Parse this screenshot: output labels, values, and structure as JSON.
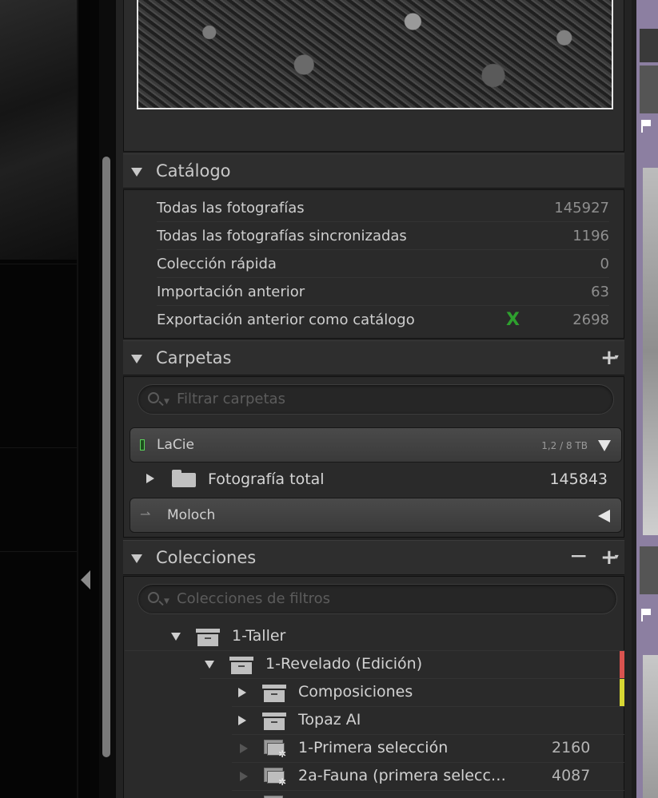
{
  "catalog": {
    "title": "Catálogo",
    "rows": [
      {
        "label": "Todas las fotografías",
        "count": "145927"
      },
      {
        "label": "Todas las fotografías sincronizadas",
        "count": "1196"
      },
      {
        "label": "Colección rápida",
        "count": "0"
      },
      {
        "label": "Importación anterior",
        "count": "63"
      },
      {
        "label": "Exportación anterior como catálogo",
        "count": "2698",
        "mark": "X"
      }
    ]
  },
  "folders": {
    "title": "Carpetas",
    "filter_placeholder": "Filtrar carpetas",
    "volume1": {
      "name": "LaCie",
      "size": "1,2 / 8 TB"
    },
    "folder": {
      "label": "Fotografía total",
      "count": "145843"
    },
    "volume2": {
      "name": "Moloch"
    }
  },
  "collections": {
    "title": "Colecciones",
    "filter_placeholder": "Colecciones de filtros",
    "items": [
      {
        "label": "1-Taller",
        "count": ""
      },
      {
        "label": "1-Revelado (Edición)",
        "count": "",
        "color": "#d9534f"
      },
      {
        "label": "Composiciones",
        "count": "",
        "color": "#d7d733"
      },
      {
        "label": "Topaz AI",
        "count": ""
      },
      {
        "label": "1-Primera selección",
        "count": "2160"
      },
      {
        "label": "2a-Fauna (primera selecc…",
        "count": "4087"
      }
    ]
  },
  "colors": {
    "accent_green": "#2ea02e",
    "right_strip": "#8c7fa1"
  }
}
